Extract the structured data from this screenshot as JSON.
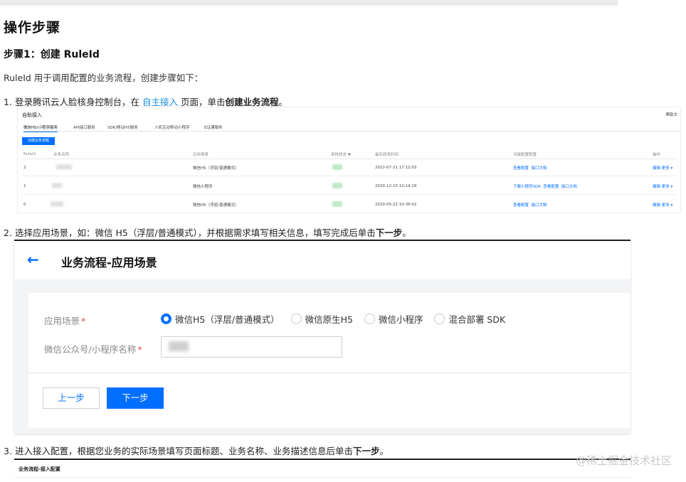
{
  "heading": "操作步骤",
  "subheading": "步骤1：创建 RuleId",
  "intro": "RuleId 用于调用配置的业务流程，创建步骤如下：",
  "steps": [
    {
      "num": "1.",
      "text_before": "登录腾讯云人脸核身控制台，在 ",
      "link": "自主接入",
      "text_middle": " 页面，单击",
      "bold": "创建业务流程",
      "text_after": "。"
    },
    {
      "num": "2.",
      "text_before": "选择应用场景，如：微信 H5（浮层/普通模式），并根据需求填写相关信息，填写完成后单击",
      "bold": "下一步",
      "text_after": "。"
    },
    {
      "num": "3.",
      "text_before": "进入接入配置，根据您业务的实际场景填写页面标题、业务名称、业务描述信息后单击",
      "bold": "下一步",
      "text_after": "。"
    }
  ],
  "console": {
    "title": "自助接入",
    "right_text": "帮助文",
    "tabs": [
      "微信H5/小程序服务",
      "API接口服务",
      "SDK/移动H5服务",
      "人机互动移动小程序",
      "E证通服务"
    ],
    "create_button": "创建业务流程",
    "columns": [
      "RuleId",
      "业务名称",
      "应用场景",
      "审核状态",
      "最后修改时间",
      "对接配置配置",
      "操作"
    ],
    "rows": [
      {
        "id": "2",
        "scene": "微信H5（浮层/普通模式）",
        "time": "2022-07-21 17:12:03",
        "links": [
          "查看配置",
          "接口文档"
        ],
        "ops": [
          "编辑",
          "更多"
        ]
      },
      {
        "id": "1",
        "scene": "微信小程序",
        "time": "2020-12-15 10:14:19",
        "links": [
          "下载小程序SDK",
          "查看配置",
          "接口文档"
        ],
        "ops": [
          "编辑",
          "更多"
        ]
      },
      {
        "id": "0",
        "scene": "微信H5（浮层/普通模式）",
        "time": "2020-05-22 10:36:02",
        "links": [
          "查看配置",
          "接口文档"
        ],
        "ops": [
          "编辑",
          "更多"
        ]
      }
    ]
  },
  "scenario_form": {
    "back_icon": "arrow-left-icon",
    "title": "业务流程-应用场景",
    "scene_label": "应用场景",
    "required_mark": "*",
    "options": [
      "微信H5（浮层/普通模式）",
      "微信原生H5",
      "微信小程序",
      "混合部署 SDK"
    ],
    "selected_index": 0,
    "name_label": "微信公众号/小程序名称",
    "prev_button": "上一步",
    "next_button": "下一步",
    "accent": "#006eff"
  },
  "config_screen": {
    "title": "业务流程-接入配置"
  },
  "watermark": "@稀土掘金技术社区"
}
